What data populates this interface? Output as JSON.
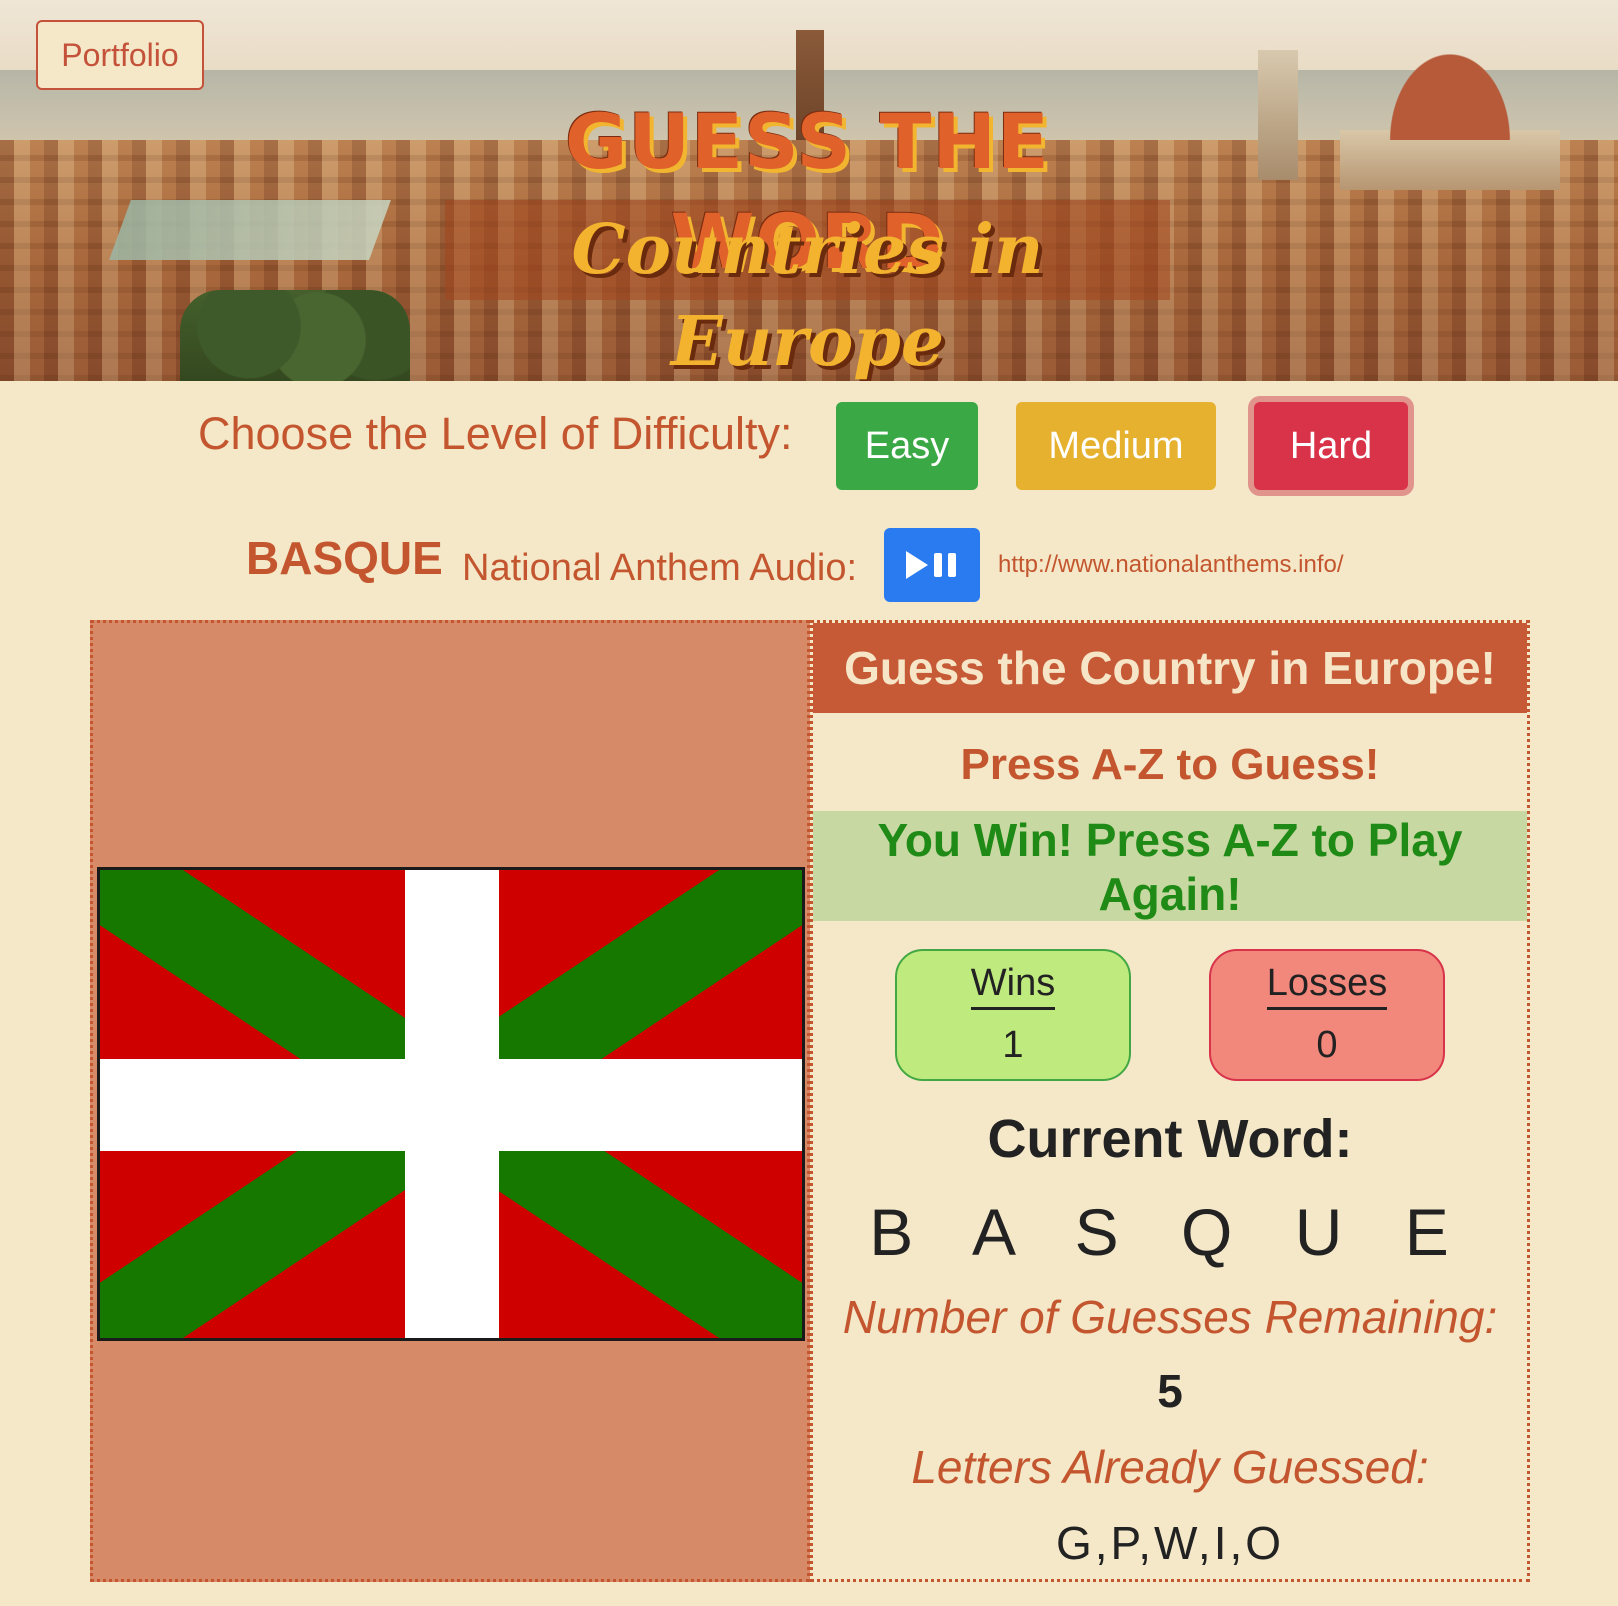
{
  "header": {
    "portfolio_label": "Portfolio",
    "title": "GUESS THE WORD",
    "subtitle": "Countries in Europe"
  },
  "difficulty": {
    "label": "Choose the Level of Difficulty:",
    "easy": "Easy",
    "medium": "Medium",
    "hard": "Hard",
    "selected": "Hard"
  },
  "anthem": {
    "country": "BASQUE",
    "label": "National Anthem Audio:",
    "play_icon": "play-pause-icon",
    "link": "http://www.nationalanthems.info/"
  },
  "game": {
    "heading": "Guess the Country in Europe!",
    "instruction": "Press A-Z to Guess!",
    "win_message": "You Win! Press A-Z to Play Again!",
    "wins_label": "Wins",
    "wins_value": "1",
    "losses_label": "Losses",
    "losses_value": "0",
    "current_label": "Current Word:",
    "current_word": "B A S Q U E",
    "remaining_label": "Number of Guesses Remaining:",
    "remaining_value": "5",
    "guessed_label": "Letters Already Guessed:",
    "guessed_value": "G,P,W,I,O"
  },
  "colors": {
    "page_bg": "#f4e8c8",
    "accent": "#c4562f",
    "flag_red": "#cf0000",
    "flag_green": "#177800",
    "flag_white": "#ffffff"
  }
}
